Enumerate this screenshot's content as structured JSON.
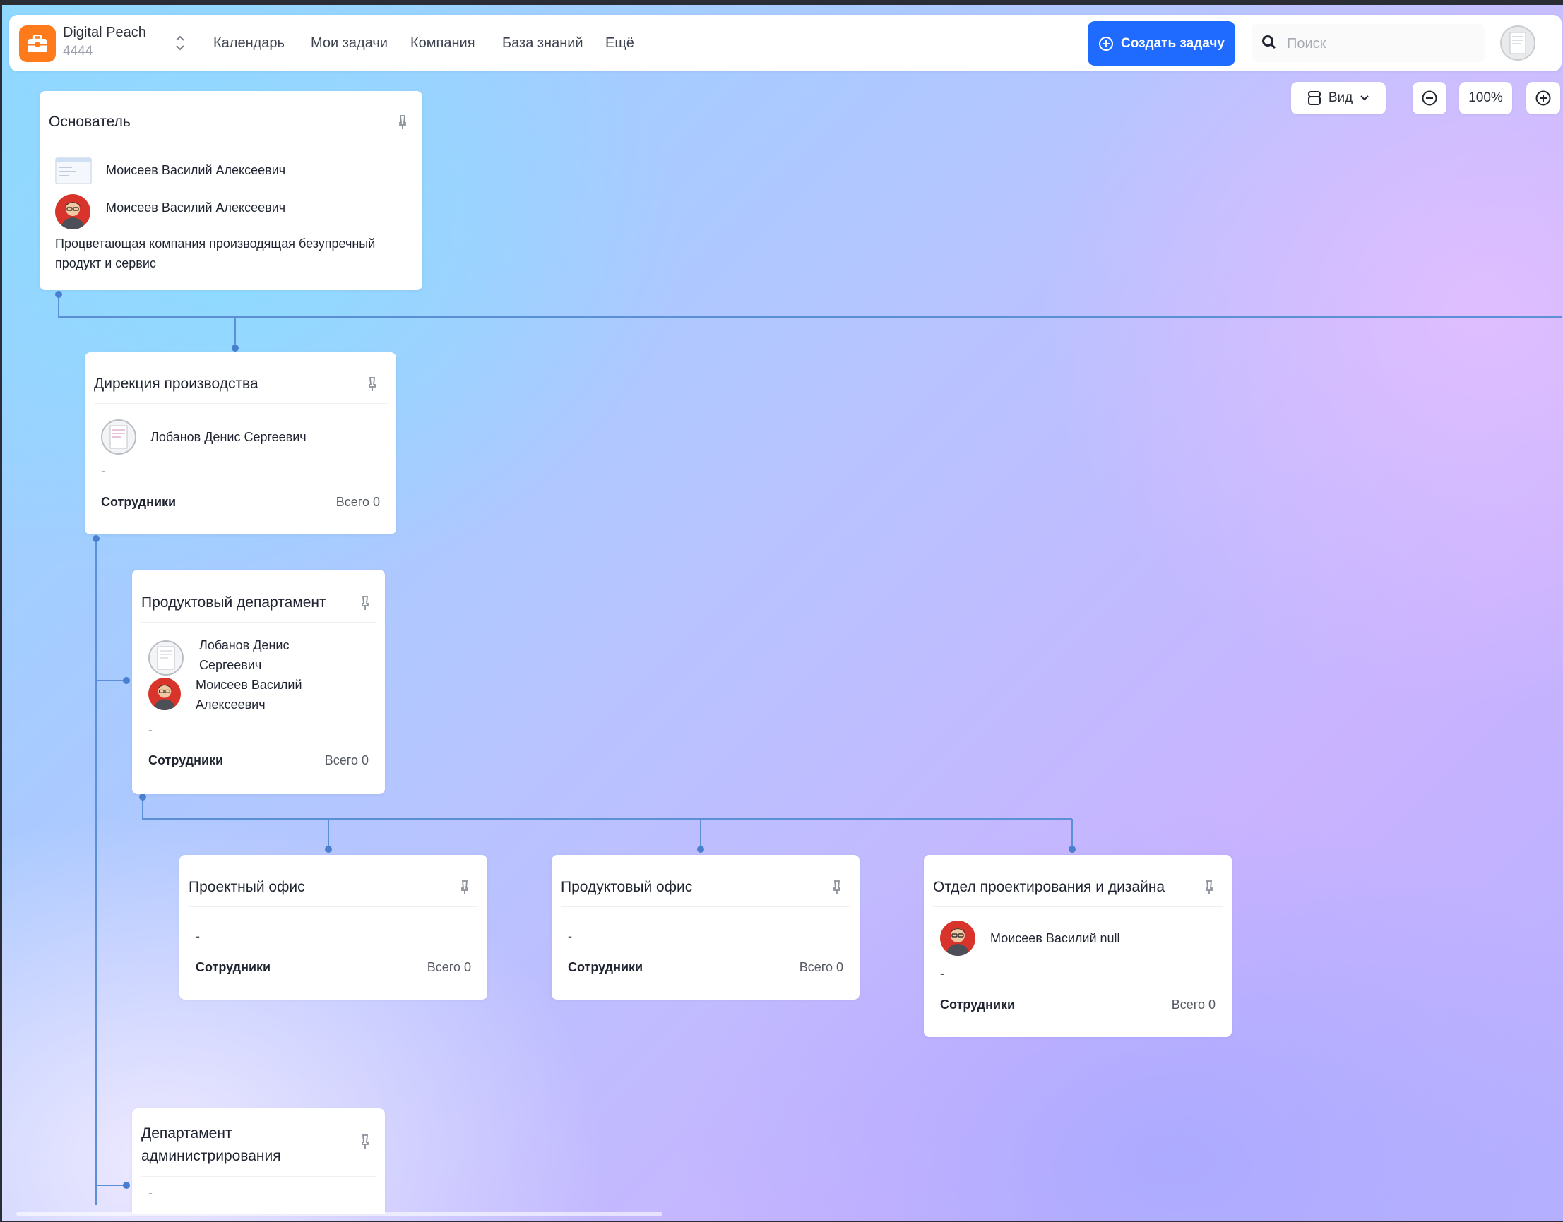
{
  "app": {
    "org_name": "Digital Peach",
    "org_id": "4444",
    "nav": [
      "Календарь",
      "Мои задачи",
      "Компания",
      "База знаний",
      "Ещё"
    ],
    "create_task": "Создать задачу",
    "search_placeholder": "Поиск",
    "accent_color": "#1f6bff",
    "logo_color": "#ff7a1a"
  },
  "toolbar": {
    "view_label": "Вид",
    "zoom": "100%"
  },
  "cards": {
    "founder": {
      "title": "Основатель",
      "people": [
        "Моисеев Василий Алексеевич",
        "Моисеев Василий Алексеевич"
      ],
      "description": "Процветающая компания производящая безупречный продукт и сервис"
    },
    "production": {
      "title": "Дирекция производства",
      "people": [
        "Лобанов Денис Сергеевич"
      ],
      "dash": "-",
      "employees_label": "Сотрудники",
      "employees_count": "Всего 0"
    },
    "product_dept": {
      "title": "Продуктовый департамент",
      "people": [
        "Лобанов Денис Сергеевич",
        "Моисеев Василий Алексеевич"
      ],
      "dash": "-",
      "employees_label": "Сотрудники",
      "employees_count": "Всего 0"
    },
    "project_office": {
      "title": "Проектный офис",
      "dash": "-",
      "employees_label": "Сотрудники",
      "employees_count": "Всего 0"
    },
    "product_office": {
      "title": "Продуктовый офис",
      "dash": "-",
      "employees_label": "Сотрудники",
      "employees_count": "Всего 0"
    },
    "design_dept": {
      "title": "Отдел проектирования и дизайна",
      "people": [
        "Моисеев Василий null"
      ],
      "dash": "-",
      "employees_label": "Сотрудники",
      "employees_count": "Всего 0"
    },
    "admin_dept": {
      "title": "Департамент администрирования",
      "dash": "-"
    }
  }
}
